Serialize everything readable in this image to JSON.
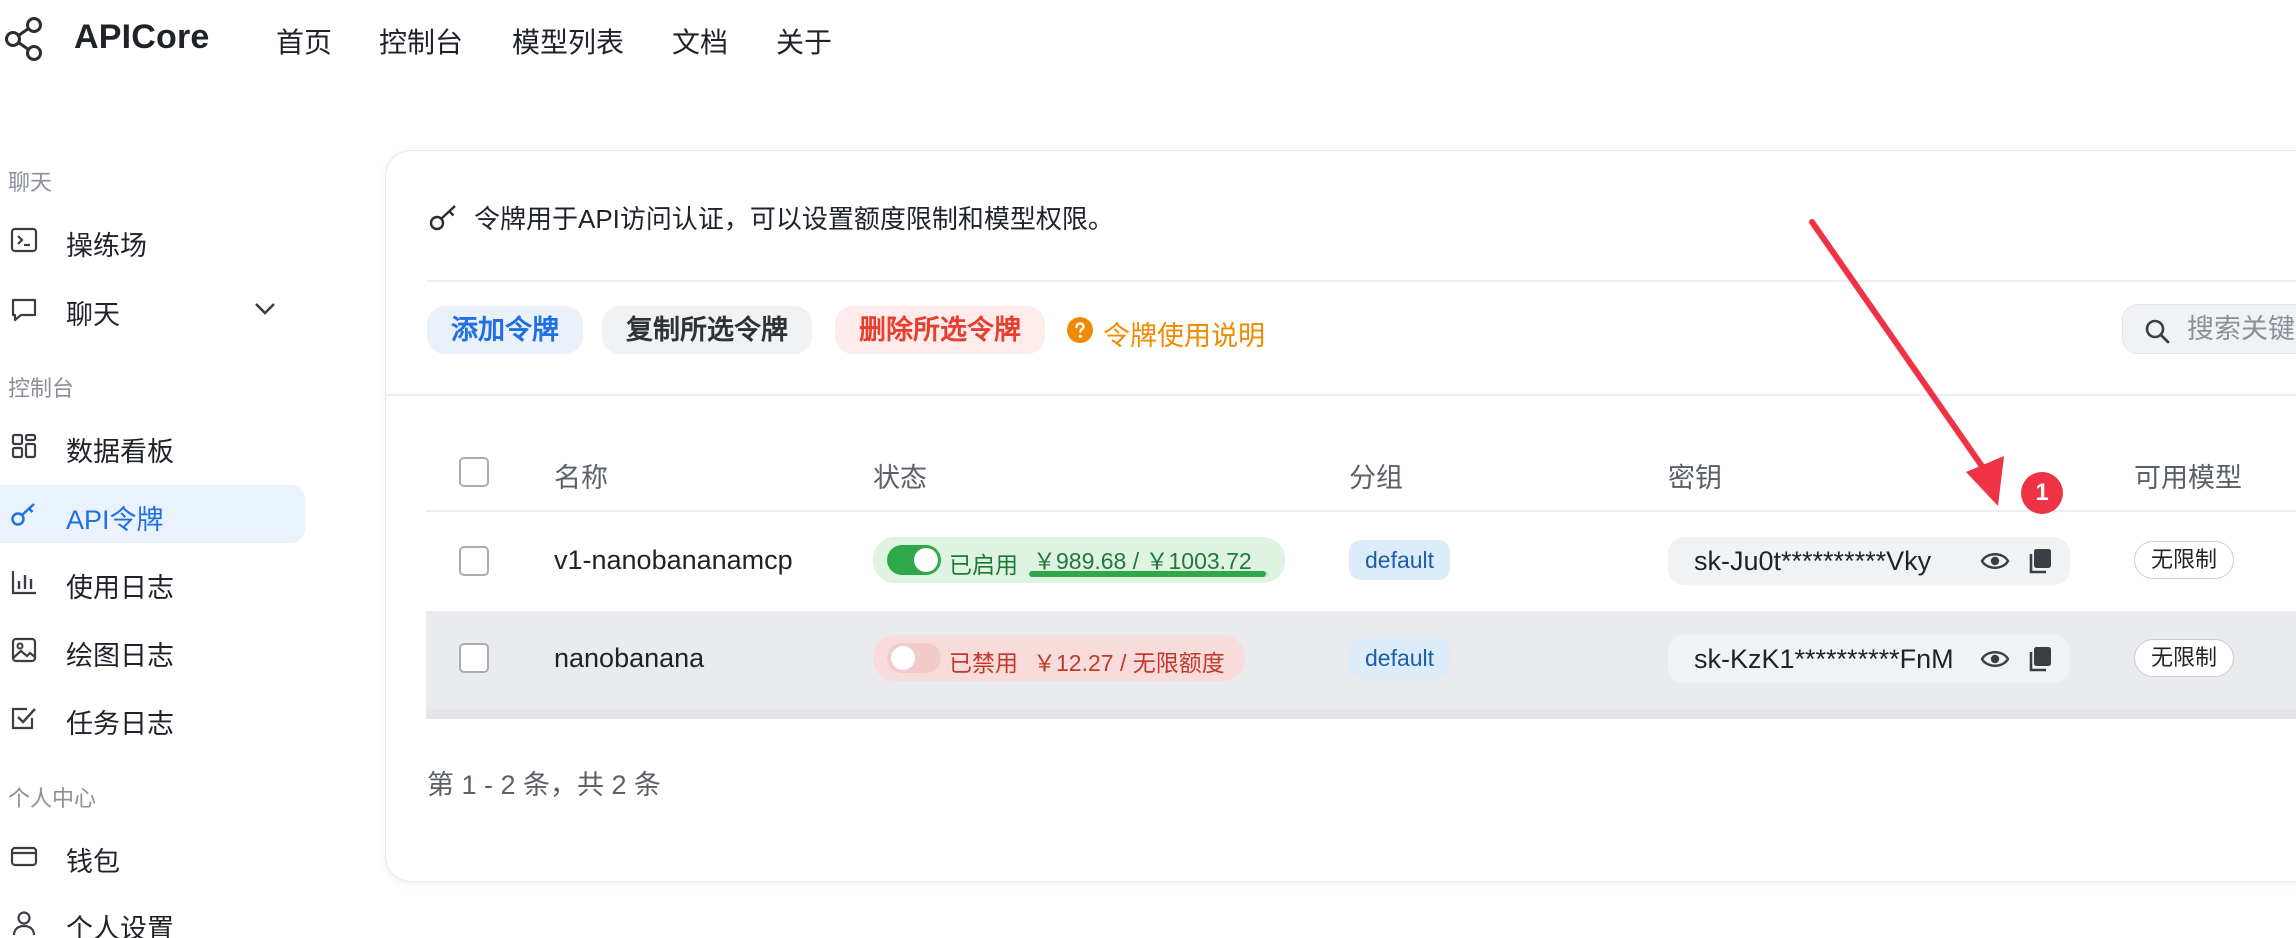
{
  "app": {
    "title": "APICore",
    "nav": [
      "首页",
      "控制台",
      "模型列表",
      "文档",
      "关于"
    ]
  },
  "sidebar": {
    "sections": [
      {
        "title": "聊天",
        "items": [
          {
            "label": "操练场",
            "icon": "terminal-icon"
          },
          {
            "label": "聊天",
            "icon": "chat-bubble-icon",
            "expandable": true
          }
        ]
      },
      {
        "title": "控制台",
        "items": [
          {
            "label": "数据看板",
            "icon": "dashboard-grid-icon"
          },
          {
            "label": "API令牌",
            "icon": "key-icon",
            "active": true
          },
          {
            "label": "使用日志",
            "icon": "bar-chart-icon"
          },
          {
            "label": "绘图日志",
            "icon": "image-icon"
          },
          {
            "label": "任务日志",
            "icon": "checkbox-task-icon"
          }
        ]
      },
      {
        "title": "个人中心",
        "items": [
          {
            "label": "钱包",
            "icon": "wallet-icon"
          },
          {
            "label": "个人设置",
            "icon": "user-icon"
          }
        ]
      }
    ]
  },
  "main": {
    "info_text": "令牌用于API访问认证，可以设置额度限制和模型权限。",
    "toolbar": {
      "add_label": "添加令牌",
      "copy_label": "复制所选令牌",
      "delete_label": "删除所选令牌",
      "help_label": "令牌使用说明",
      "search_placeholder": "搜索关键字"
    },
    "table": {
      "columns": [
        "名称",
        "状态",
        "分组",
        "密钥",
        "可用模型"
      ],
      "rows": [
        {
          "name": "v1-nanobananamcp",
          "enabled": true,
          "status_label": "已启用",
          "quota_text": "￥989.68 / ￥1003.72",
          "quota_fraction": 0.986,
          "group": "default",
          "key": "sk-Ju0t**********Vky",
          "models": "无限制"
        },
        {
          "name": "nanobanana",
          "enabled": false,
          "status_label": "已禁用",
          "quota_text": "￥12.27 / 无限额度",
          "group": "default",
          "key": "sk-KzK1**********FnM",
          "models": "无限制"
        }
      ]
    },
    "pagination_text": "第 1 - 2 条，共 2 条"
  },
  "annotation": {
    "badge": "1",
    "color": "#ef3345"
  },
  "colors": {
    "accent": "#1f6fe5",
    "success": "#2fa84a",
    "danger": "#e5402f",
    "warning": "#f08a00"
  }
}
